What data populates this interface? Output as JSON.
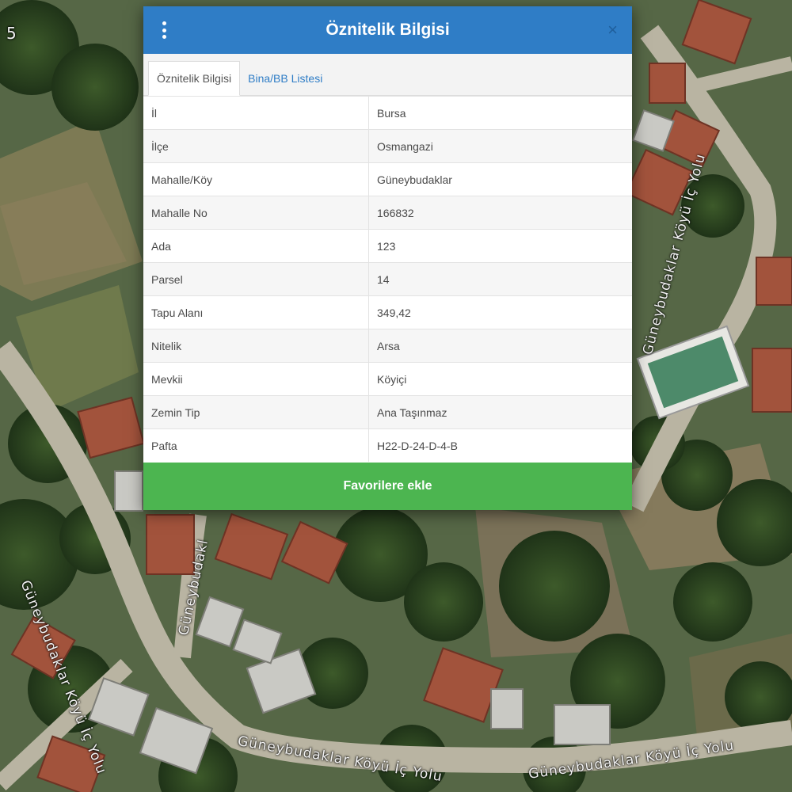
{
  "modal": {
    "title": "Öznitelik Bilgisi",
    "close_label": "×",
    "tabs": [
      {
        "label": "Öznitelik Bilgisi"
      },
      {
        "label": "Bina/BB Listesi"
      }
    ],
    "rows": [
      {
        "key": "İl",
        "value": "Bursa"
      },
      {
        "key": "İlçe",
        "value": "Osmangazi"
      },
      {
        "key": "Mahalle/Köy",
        "value": "Güneybudaklar"
      },
      {
        "key": "Mahalle No",
        "value": "166832"
      },
      {
        "key": "Ada",
        "value": "123"
      },
      {
        "key": "Parsel",
        "value": "14"
      },
      {
        "key": "Tapu Alanı",
        "value": "349,42"
      },
      {
        "key": "Nitelik",
        "value": "Arsa"
      },
      {
        "key": "Mevkii",
        "value": "Köyiçi"
      },
      {
        "key": "Zemin Tip",
        "value": "Ana Taşınmaz"
      },
      {
        "key": "Pafta",
        "value": "H22-D-24-D-4-B"
      }
    ],
    "favorite_button": "Favorilere ekle",
    "header_color": "#2f7dc6",
    "button_color": "#4cb550",
    "menu_icon": "kebab-menu-icon"
  },
  "map": {
    "road_labels": [
      "Güneybudaklar Köyü İç Yolu",
      "Güneybudakl",
      "Güneybudaklar Köyü İç Yolu",
      "Güneybudaklar Köyü İç Yolu",
      "Güneybudaklar Köyü İç Yolu"
    ],
    "corner_mark": "5"
  }
}
